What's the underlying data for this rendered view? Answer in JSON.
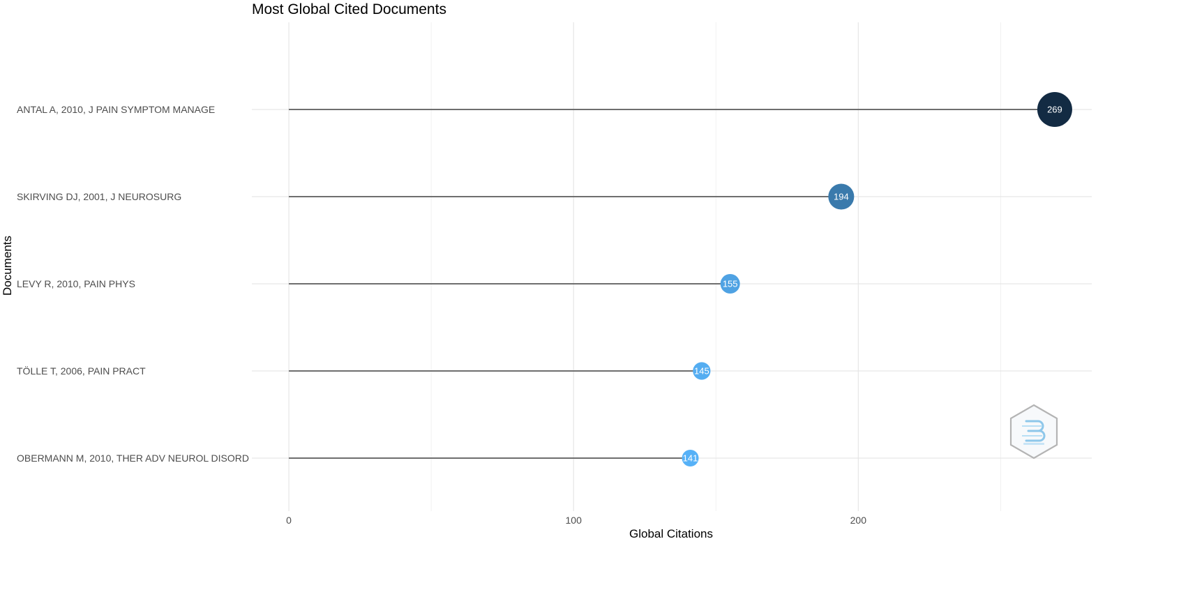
{
  "chart_data": {
    "type": "scatter",
    "title": "Most Global Cited Documents",
    "xlabel": "Global Citations",
    "ylabel": "Documents",
    "categories": [
      "ANTAL A, 2010, J PAIN SYMPTOM MANAGE",
      "SKIRVING DJ, 2001, J NEUROSURG",
      "LEVY R, 2010, PAIN PHYS",
      "TÖLLE T, 2006, PAIN PRACT",
      "OBERMANN M, 2010, THER ADV NEUROL DISORD"
    ],
    "values": [
      269,
      194,
      155,
      145,
      141
    ],
    "point_labels": [
      "269",
      "194",
      "155",
      "145",
      "141"
    ],
    "xlim": [
      -13,
      282
    ],
    "x_major_ticks": [
      0,
      100,
      200
    ],
    "x_tick_labels": [
      "0",
      "100",
      "200"
    ],
    "x_minor_ticks": [
      50,
      150,
      250
    ],
    "grid": true,
    "legend": "none",
    "color_scale": {
      "low": "#56b1f7",
      "high": "#132b43"
    },
    "segment_color": "#6e6e6e",
    "watermark_icon": "bibliometrix-hexagon-logo"
  }
}
